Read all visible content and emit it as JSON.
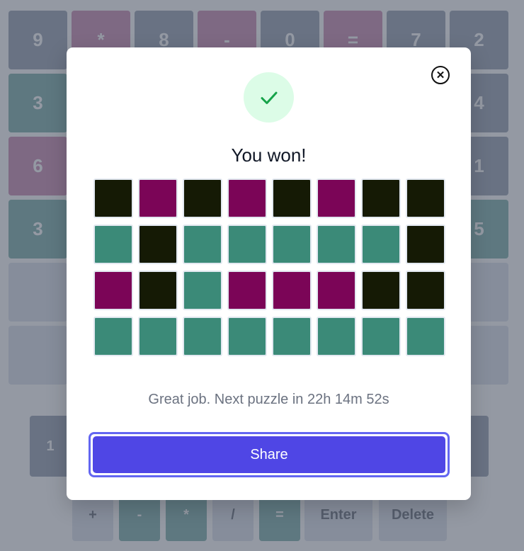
{
  "board": {
    "rows": [
      [
        {
          "v": "9",
          "s": "absent"
        },
        {
          "v": "*",
          "s": "present"
        },
        {
          "v": "8",
          "s": "absent"
        },
        {
          "v": "-",
          "s": "present"
        },
        {
          "v": "0",
          "s": "absent"
        },
        {
          "v": "=",
          "s": "present"
        },
        {
          "v": "7",
          "s": "absent"
        },
        {
          "v": "2",
          "s": "absent"
        }
      ],
      [
        {
          "v": "3",
          "s": "correct"
        },
        {
          "v": "",
          "s": "absent"
        },
        {
          "v": "",
          "s": "correct"
        },
        {
          "v": "",
          "s": "correct"
        },
        {
          "v": "",
          "s": "correct"
        },
        {
          "v": "",
          "s": "correct"
        },
        {
          "v": "",
          "s": "correct"
        },
        {
          "v": "4",
          "s": "absent"
        }
      ],
      [
        {
          "v": "6",
          "s": "present"
        },
        {
          "v": "",
          "s": "absent"
        },
        {
          "v": "",
          "s": "correct"
        },
        {
          "v": "",
          "s": "present"
        },
        {
          "v": "",
          "s": "present"
        },
        {
          "v": "",
          "s": "present"
        },
        {
          "v": "",
          "s": "absent"
        },
        {
          "v": "1",
          "s": "absent"
        }
      ],
      [
        {
          "v": "3",
          "s": "correct"
        },
        {
          "v": "",
          "s": "correct"
        },
        {
          "v": "",
          "s": "correct"
        },
        {
          "v": "",
          "s": "correct"
        },
        {
          "v": "",
          "s": "correct"
        },
        {
          "v": "",
          "s": "correct"
        },
        {
          "v": "",
          "s": "correct"
        },
        {
          "v": "5",
          "s": "correct"
        }
      ],
      [
        {
          "v": "",
          "s": "empty"
        },
        {
          "v": "",
          "s": "empty"
        },
        {
          "v": "",
          "s": "empty"
        },
        {
          "v": "",
          "s": "empty"
        },
        {
          "v": "",
          "s": "empty"
        },
        {
          "v": "",
          "s": "empty"
        },
        {
          "v": "",
          "s": "empty"
        },
        {
          "v": "",
          "s": "empty"
        }
      ],
      [
        {
          "v": "",
          "s": "empty"
        },
        {
          "v": "",
          "s": "empty"
        },
        {
          "v": "",
          "s": "empty"
        },
        {
          "v": "",
          "s": "empty"
        },
        {
          "v": "",
          "s": "empty"
        },
        {
          "v": "",
          "s": "empty"
        },
        {
          "v": "",
          "s": "empty"
        },
        {
          "v": "",
          "s": "empty"
        }
      ]
    ]
  },
  "keyboard": {
    "row1": [
      {
        "label": "1",
        "s": "absent"
      },
      {
        "label": "",
        "s": "absent"
      }
    ],
    "row2": [
      {
        "label": "+",
        "s": "plain"
      },
      {
        "label": "-",
        "s": "correct"
      },
      {
        "label": "*",
        "s": "correct"
      },
      {
        "label": "/",
        "s": "plain"
      },
      {
        "label": "=",
        "s": "correct"
      },
      {
        "label": "Enter",
        "s": "plain"
      },
      {
        "label": "Delete",
        "s": "plain"
      }
    ]
  },
  "modal": {
    "title": "You won!",
    "close_icon": "close-circle-icon",
    "success_icon": "check-icon",
    "grid": [
      [
        "absent",
        "present",
        "absent",
        "present",
        "absent",
        "present",
        "absent",
        "absent"
      ],
      [
        "correct",
        "absent",
        "correct",
        "correct",
        "correct",
        "correct",
        "correct",
        "absent"
      ],
      [
        "present",
        "absent",
        "correct",
        "present",
        "present",
        "present",
        "absent",
        "absent"
      ],
      [
        "correct",
        "correct",
        "correct",
        "correct",
        "correct",
        "correct",
        "correct",
        "correct"
      ]
    ],
    "next_puzzle_text": "Great job. Next puzzle in 22h 14m 52s",
    "share_label": "Share"
  },
  "colors": {
    "absent": "#151a05",
    "present": "#7b0557",
    "correct": "#3b8a78",
    "share_button": "#4f46e5",
    "check_green": "#16a34a"
  }
}
